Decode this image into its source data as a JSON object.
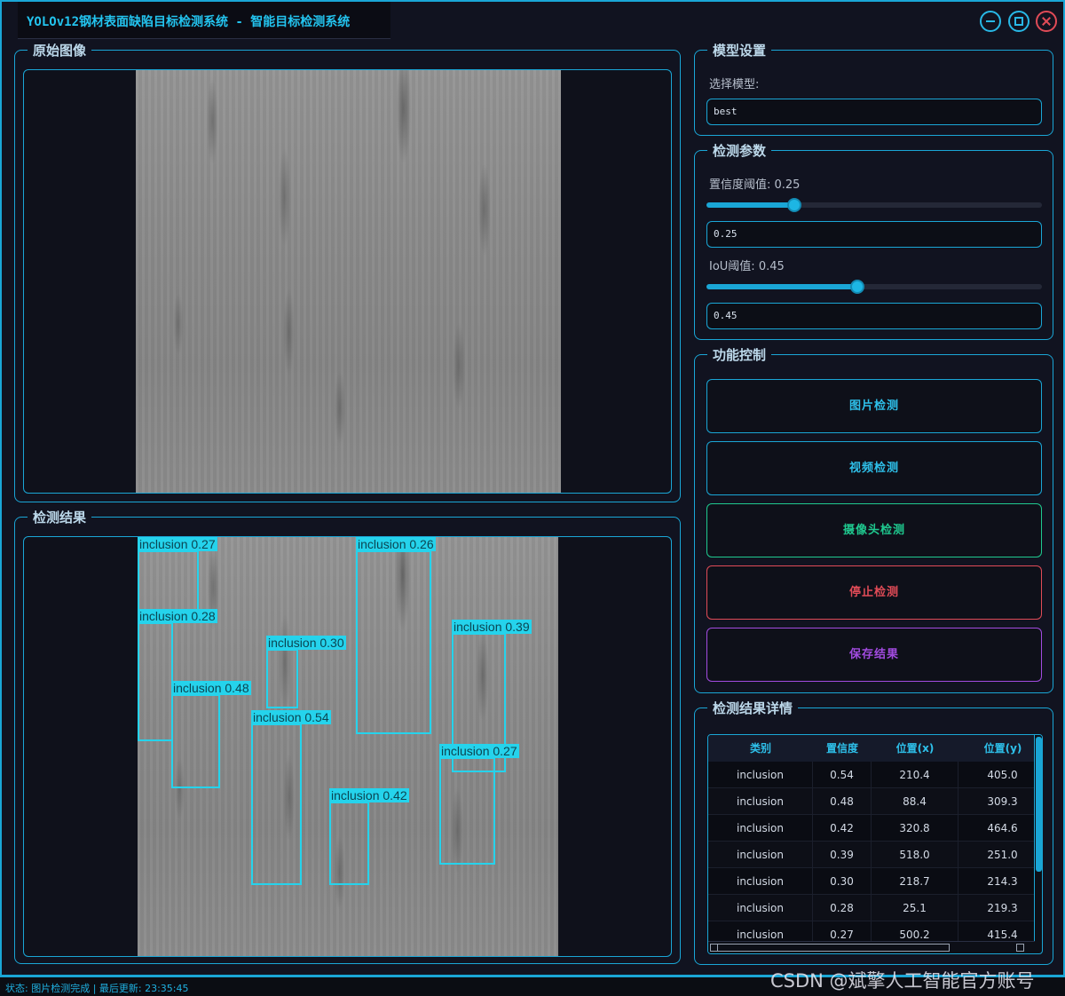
{
  "window": {
    "title": "YOLOv12钢材表面缺陷目标检测系统 - 智能目标检测系统"
  },
  "panels": {
    "original_title": "原始图像",
    "result_title": "检测结果",
    "model_title": "模型设置",
    "params_title": "检测参数",
    "control_title": "功能控制",
    "details_title": "检测结果详情"
  },
  "model": {
    "label": "选择模型:",
    "value": "best"
  },
  "params": {
    "conf_label": "置信度阈值: 0.25",
    "conf_value": "0.25",
    "conf_fraction": 0.25,
    "iou_label": "IoU阈值: 0.45",
    "iou_value": "0.45",
    "iou_fraction": 0.45
  },
  "controls": {
    "image_detect": "图片检测",
    "video_detect": "视频检测",
    "camera_detect": "摄像头检测",
    "stop_detect": "停止检测",
    "save_result": "保存结果"
  },
  "colors": {
    "accent": "#1aa6d6",
    "detection_box": "#25d3ec",
    "camera_button": "#1fc98f",
    "stop_button": "#e04b57",
    "save_button": "#a24be0"
  },
  "detections": [
    {
      "label": "inclusion 0.27"
    },
    {
      "label": "inclusion 0.26"
    },
    {
      "label": "inclusion 0.28"
    },
    {
      "label": "inclusion 0.30"
    },
    {
      "label": "inclusion 0.39"
    },
    {
      "label": "inclusion 0.48"
    },
    {
      "label": "inclusion 0.54"
    },
    {
      "label": "inclusion 0.27"
    },
    {
      "label": "inclusion 0.42"
    }
  ],
  "table": {
    "headers": [
      "类别",
      "置信度",
      "位置(x)",
      "位置(y)"
    ],
    "rows": [
      [
        "inclusion",
        "0.54",
        "210.4",
        "405.0"
      ],
      [
        "inclusion",
        "0.48",
        "88.4",
        "309.3"
      ],
      [
        "inclusion",
        "0.42",
        "320.8",
        "464.6"
      ],
      [
        "inclusion",
        "0.39",
        "518.0",
        "251.0"
      ],
      [
        "inclusion",
        "0.30",
        "218.7",
        "214.3"
      ],
      [
        "inclusion",
        "0.28",
        "25.1",
        "219.3"
      ],
      [
        "inclusion",
        "0.27",
        "500.2",
        "415.4"
      ]
    ]
  },
  "status": {
    "text": "状态: 图片检测完成 | 最后更新: 23:35:45"
  },
  "watermark": "CSDN @斌擎人工智能官方账号"
}
